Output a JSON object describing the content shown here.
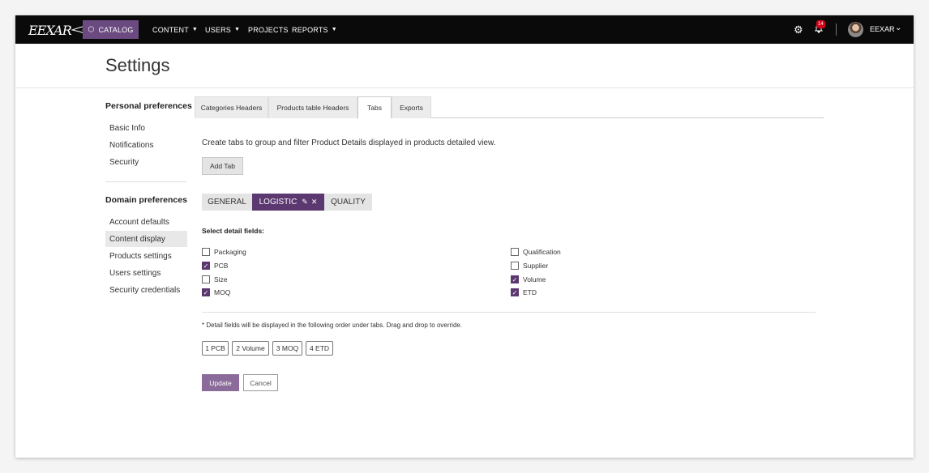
{
  "brand": {
    "logo_text": "EEXAR",
    "accent": "#5b3870"
  },
  "nav": {
    "catalog": "CATALOG",
    "content": "CONTENT",
    "users": "USERS",
    "projects": "PROJECTS",
    "reports": "REPORTS",
    "notification_count": "14",
    "username": "EEXAR"
  },
  "page": {
    "title": "Settings"
  },
  "sidebar": {
    "personal_heading": "Personal preferences",
    "personal_items": [
      "Basic Info",
      "Notifications",
      "Security"
    ],
    "domain_heading": "Domain preferences",
    "domain_items": [
      "Account defaults",
      "Content display",
      "Products settings",
      "Users settings",
      "Security credentials"
    ],
    "active_item": "Content display"
  },
  "tabs": {
    "items": [
      "Categories Headers",
      "Products table Headers",
      "Tabs",
      "Exports"
    ],
    "active": "Tabs"
  },
  "content": {
    "description": "Create tabs to group and filter Product Details displayed in products detailed view.",
    "add_tab_label": "Add Tab",
    "detail_tabs": [
      "GENERAL",
      "LOGISTIC",
      "QUALITY"
    ],
    "active_detail_tab": "LOGISTIC",
    "select_label": "Select detail fields:",
    "fields_left": [
      {
        "label": "Packaging",
        "checked": false
      },
      {
        "label": "PCB",
        "checked": true
      },
      {
        "label": "Size",
        "checked": false
      },
      {
        "label": "MOQ",
        "checked": true
      }
    ],
    "fields_right": [
      {
        "label": "Qualification",
        "checked": false
      },
      {
        "label": "Supplier",
        "checked": false
      },
      {
        "label": "Volume",
        "checked": true
      },
      {
        "label": "ETD",
        "checked": true
      }
    ],
    "order_note": "* Detail fields will be displayed in the following order under tabs. Drag and drop to override.",
    "order_chips": [
      "1 PCB",
      "2 Volume",
      "3 MOQ",
      "4 ETD"
    ],
    "update_label": "Update",
    "cancel_label": "Cancel"
  }
}
